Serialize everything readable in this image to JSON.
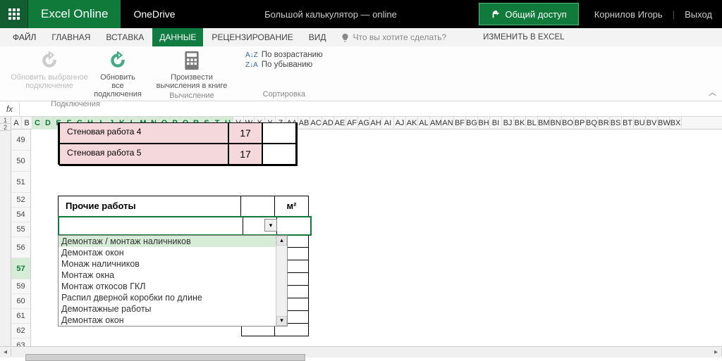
{
  "topbar": {
    "brand": "Excel Online",
    "onedrive": "OneDrive",
    "doc_title": "Большой калькулятор — online",
    "share": "Общий доступ",
    "user": "Корнилов Игорь",
    "signout": "Выход"
  },
  "tabs": {
    "file": "ФАЙЛ",
    "home": "ГЛАВНАЯ",
    "insert": "ВСТАВКА",
    "data": "ДАННЫЕ",
    "review": "РЕЦЕНЗИРОВАНИЕ",
    "view": "ВИД",
    "tell_me": "Что вы хотите сделать?",
    "edit_in_excel": "ИЗМЕНИТЬ В EXCEL"
  },
  "ribbon": {
    "refresh_selected": "Обновить выбранное подключение",
    "refresh_all": "Обновить все подключения",
    "group_conn": "Подключения",
    "recalc": "Произвести вычисления в книге",
    "group_calc": "Вычисление",
    "sort_asc": "По возрастанию",
    "sort_desc": "По убыванию",
    "group_sort": "Сортировка"
  },
  "formula": {
    "fx": "fx"
  },
  "columns_all": [
    "A",
    "B",
    "C",
    "D",
    "E",
    "F",
    "G",
    "H",
    "I",
    "J",
    "K",
    "L",
    "M",
    "N",
    "O",
    "P",
    "Q",
    "R",
    "S",
    "T",
    "U",
    "V",
    "W",
    "X",
    "Y",
    "Z",
    "AA",
    "AB",
    "AC",
    "AD",
    "AE",
    "AF",
    "AG",
    "AH",
    "AI",
    "AJ",
    "AK",
    "AL",
    "AM",
    "AN",
    "BF",
    "BG",
    "BH",
    "BI",
    "BJ",
    "BK",
    "BL",
    "BM",
    "BN",
    "BO",
    "BP",
    "BQ",
    "BR",
    "BS",
    "BT",
    "BU",
    "BV",
    "BW",
    "BX"
  ],
  "sel_cols": [
    "C",
    "D",
    "E",
    "F",
    "G",
    "H",
    "I",
    "J",
    "K",
    "L",
    "M",
    "N",
    "O",
    "P",
    "Q",
    "R",
    "S",
    "T",
    "U"
  ],
  "rows": [
    "49",
    "50",
    "51",
    "52",
    "54",
    "55",
    "56",
    "57",
    "59",
    "60",
    "61",
    "62",
    "63"
  ],
  "selected_row": "57",
  "tall_rows": [
    "49",
    "50",
    "51",
    "56",
    "57"
  ],
  "wall": {
    "r1_label": "Стеновая работа 4",
    "r1_val": "17",
    "r2_label": "Стеновая работа 5",
    "r2_val": "17"
  },
  "misc": {
    "title": "Прочие работы",
    "unit": "м²"
  },
  "dropdown": {
    "items": [
      "Демонтаж / монтаж наличников",
      "Демонтаж окон",
      "Монаж наличников",
      "Монтаж окна",
      "Монтаж откосов ГКЛ",
      "Распил дверной коробки по  длине",
      "Демонтажные работы",
      "Демонтаж  окон"
    ]
  }
}
